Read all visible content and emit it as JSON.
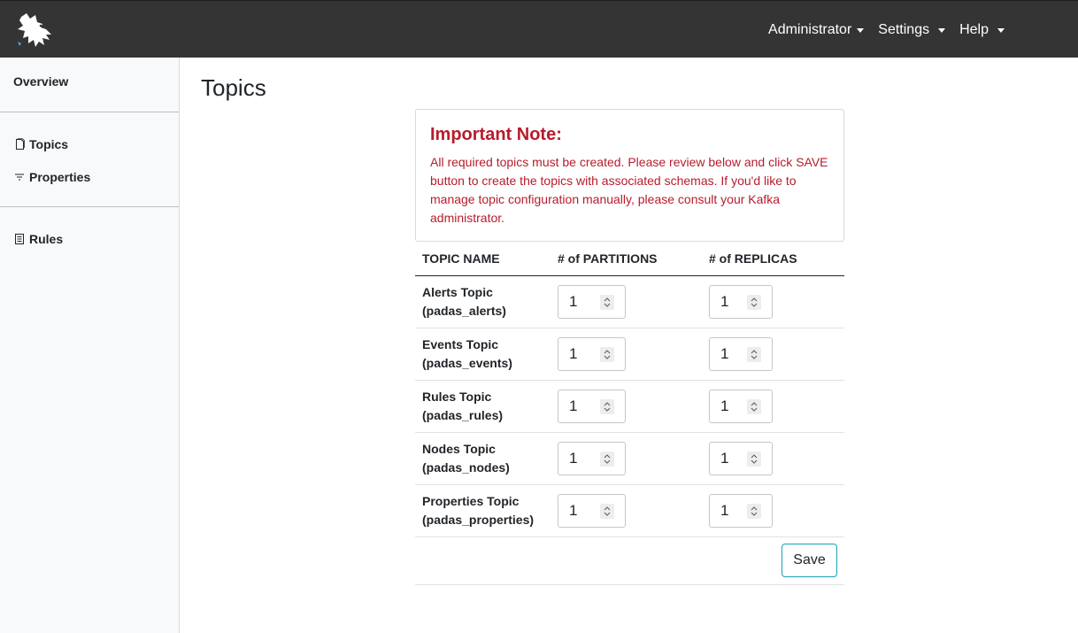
{
  "navbar": {
    "logo_icon": "dragon-logo-icon",
    "menus": [
      "Administrator",
      "Settings",
      "Help"
    ]
  },
  "sidebar": {
    "overview": "Overview",
    "items": [
      {
        "label": "Topics",
        "icon": "document-icon"
      },
      {
        "label": "Properties",
        "icon": "filter-icon"
      },
      {
        "label": "Rules",
        "icon": "list-icon"
      }
    ]
  },
  "page": {
    "title": "Topics"
  },
  "note": {
    "title": "Important Note:",
    "body": "All required topics must be created. Please review below and click SAVE button to create the topics with associated schemas. If you'd like to manage topic configuration manually, please consult your Kafka administrator.",
    "color": "#b71c2b"
  },
  "table": {
    "headers": [
      "TOPIC NAME",
      "# of PARTITIONS",
      "# of REPLICAS"
    ],
    "rows": [
      {
        "name": "Alerts Topic",
        "id": "(padas_alerts)",
        "partitions": "1",
        "replicas": "1"
      },
      {
        "name": "Events Topic",
        "id": "(padas_events)",
        "partitions": "1",
        "replicas": "1"
      },
      {
        "name": "Rules Topic",
        "id": "(padas_rules)",
        "partitions": "1",
        "replicas": "1"
      },
      {
        "name": "Nodes Topic",
        "id": "(padas_nodes)",
        "partitions": "1",
        "replicas": "1"
      },
      {
        "name": "Properties Topic",
        "id": "(padas_properties)",
        "partitions": "1",
        "replicas": "1"
      }
    ]
  },
  "actions": {
    "save_label": "Save",
    "accent": "#17a2b8"
  }
}
